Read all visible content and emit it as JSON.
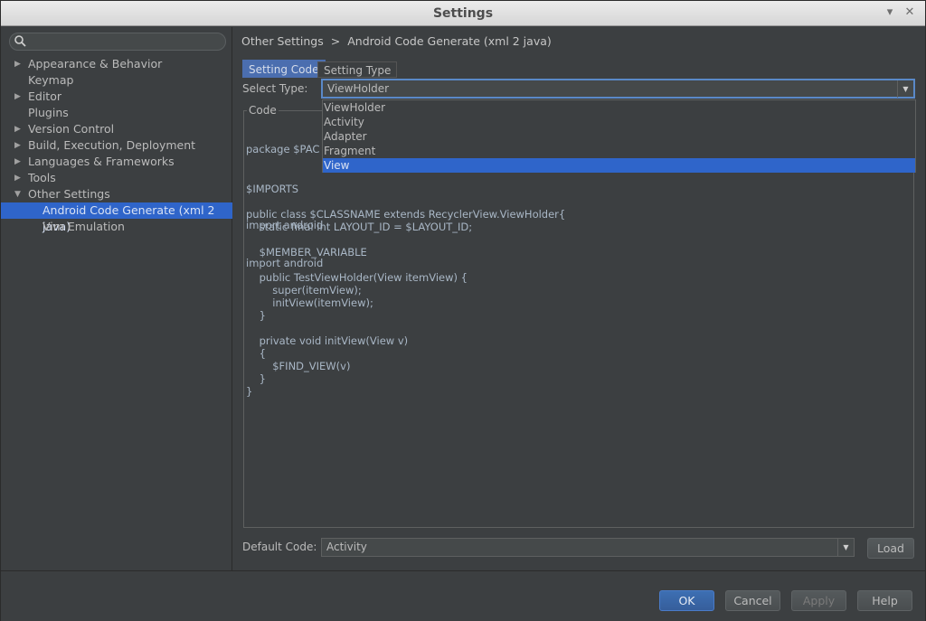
{
  "window": {
    "title": "Settings"
  },
  "search": {
    "placeholder": ""
  },
  "sidebar": {
    "items": [
      {
        "label": "Appearance & Behavior",
        "arrow": "▶"
      },
      {
        "label": "Keymap",
        "arrow": ""
      },
      {
        "label": "Editor",
        "arrow": "▶"
      },
      {
        "label": "Plugins",
        "arrow": ""
      },
      {
        "label": "Version Control",
        "arrow": "▶"
      },
      {
        "label": "Build, Execution, Deployment",
        "arrow": "▶"
      },
      {
        "label": "Languages & Frameworks",
        "arrow": "▶"
      },
      {
        "label": "Tools",
        "arrow": "▶"
      },
      {
        "label": "Other Settings",
        "arrow": "▼"
      },
      {
        "label": "Android Code Generate (xml 2 java)",
        "arrow": ""
      },
      {
        "label": "Vim Emulation",
        "arrow": ""
      }
    ]
  },
  "breadcrumb": {
    "parent": "Other Settings",
    "separator": ">",
    "current": "Android Code Generate (xml 2 java)"
  },
  "tabs": [
    {
      "label": "Setting Code"
    },
    {
      "label": "Setting Type"
    }
  ],
  "select_type": {
    "label": "Select Type:",
    "value": "ViewHolder",
    "options": [
      "ViewHolder",
      "Activity",
      "Adapter",
      "Fragment",
      "View"
    ],
    "highlighted": "View"
  },
  "code": {
    "legend": "Code",
    "head_lines": [
      "package $PAC",
      "",
      "import android",
      "import android"
    ],
    "body": "$IMPORTS\n\npublic class $CLASSNAME extends RecyclerView.ViewHolder{\n    static final int LAYOUT_ID = $LAYOUT_ID;\n\n    $MEMBER_VARIABLE\n\n    public TestViewHolder(View itemView) {\n        super(itemView);\n        initView(itemView);\n    }\n\n    private void initView(View v)\n    {\n        $FIND_VIEW(v)\n    }\n}"
  },
  "default_code": {
    "label": "Default Code:",
    "value": "Activity",
    "load": "Load"
  },
  "footer": {
    "ok": "OK",
    "cancel": "Cancel",
    "apply": "Apply",
    "help": "Help"
  },
  "icons": {
    "minimize": "chevron-down-icon",
    "close": "close-icon",
    "search": "search-icon"
  }
}
